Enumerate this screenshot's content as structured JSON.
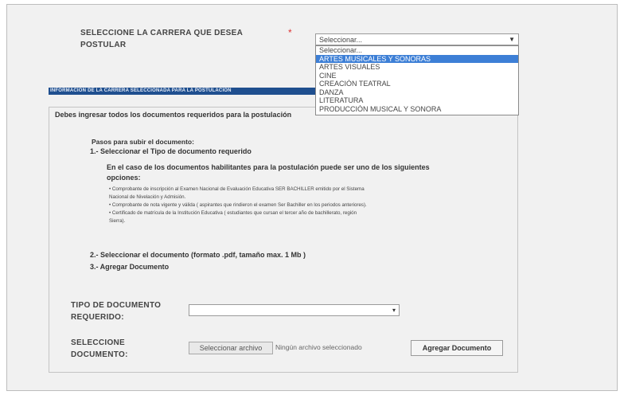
{
  "career": {
    "label_line1": "SELECCIONE LA CARRERA QUE DESEA",
    "label_line2": "POSTULAR",
    "required_mark": "*",
    "selected_value": "Seleccionar...",
    "options": [
      "Seleccionar...",
      "ARTES MUSICALES Y SONORAS",
      "ARTES VISUALES",
      "CINE",
      "CREACIÓN TEATRAL",
      "DANZA",
      "LITERATURA",
      "PRODUCCIÓN MUSICAL Y SONORA"
    ],
    "highlighted_option": "ARTES MUSICALES Y SONORAS"
  },
  "banner_text": "INFORMACIÓN DE LA CARRERA SELECCIONADA PARA LA POSTULACIÓN",
  "documents": {
    "intro": "Debes ingresar todos los documentos requeridos para la postulación",
    "steps_title": "Pasos para subir el documento:",
    "step1": "1.-  Seleccionar el Tipo de documento requerido",
    "step1_desc_line1": "En el caso de los documentos habilitantes para la postulación puede ser uno de los siguientes",
    "step1_desc_line2": "opciones:",
    "bullets": [
      "Comprobante de inscripción al Examen Nacional de Evaluación Educativa SER BACHILLER emitido por el Sistema",
      "Nacional de Nivelación y Admisión.",
      "Comprobante de nota vigente y válida ( aspirantes que rindieron el examen Ser Bachiller en los periodos anteriores).",
      "Certificado de matrícula de la Institución Educativa ( estudiantes que cursan el tercer año de bachillerato, región",
      "Sierra)."
    ],
    "step2": "2.-  Seleccionar el documento (formato .pdf, tamaño max. 1 Mb )",
    "step3": "3.-  Agregar Documento"
  },
  "doc_type": {
    "label_line1": "TIPO DE DOCUMENTO",
    "label_line2": "REQUERIDO:",
    "value": ""
  },
  "doc_select": {
    "label_line1": "SELECCIONE",
    "label_line2": "DOCUMENTO:",
    "file_button": "Seleccionar archivo",
    "file_status": "Ningún archivo seleccionado",
    "add_button": "Agregar Documento"
  },
  "colors": {
    "highlight": "#3d7fd6",
    "banner": "#1f4f8f",
    "required": "#d33333"
  }
}
